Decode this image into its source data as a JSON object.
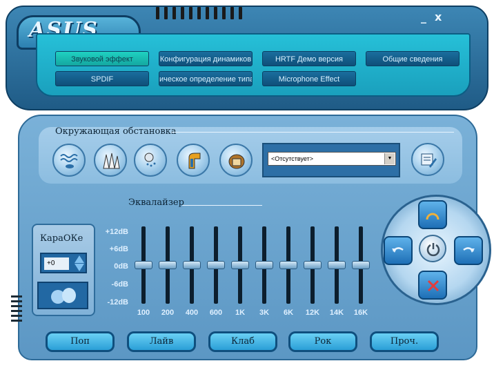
{
  "app": {
    "logo": "ASUS",
    "minimize": "_",
    "close": "x"
  },
  "nav": {
    "row1": [
      {
        "label": "Звуковой эффект",
        "active": true
      },
      {
        "label": "Конфигурация динамиков",
        "active": false
      },
      {
        "label": "HRTF Демо версия",
        "active": false
      },
      {
        "label": "Общие сведения",
        "active": false
      }
    ],
    "row2": [
      {
        "label": "SPDIF",
        "active": false
      },
      {
        "label": "ическое определение типа",
        "active": false
      },
      {
        "label": "Microphone Effect",
        "active": false
      }
    ]
  },
  "environment": {
    "title": "Окружающая обстановка",
    "icons": [
      "underwater-icon",
      "concert-hall-icon",
      "bathroom-icon",
      "sewer-pipe-icon",
      "stone-room-icon"
    ],
    "selected": "<Отсутствует>",
    "settings_icon": "settings-edit-icon"
  },
  "equalizer": {
    "title": "Эквалайзер",
    "db_labels": [
      "+12dB",
      "+6dB",
      "0dB",
      "-6dB",
      "-12dB"
    ],
    "bands": [
      {
        "freq": "100",
        "gain_db": 0
      },
      {
        "freq": "200",
        "gain_db": 0
      },
      {
        "freq": "400",
        "gain_db": 0
      },
      {
        "freq": "600",
        "gain_db": 0
      },
      {
        "freq": "1K",
        "gain_db": 0
      },
      {
        "freq": "3K",
        "gain_db": 0
      },
      {
        "freq": "6K",
        "gain_db": 0
      },
      {
        "freq": "12K",
        "gain_db": 0
      },
      {
        "freq": "14K",
        "gain_db": 0
      },
      {
        "freq": "16K",
        "gain_db": 0
      }
    ]
  },
  "karaoke": {
    "label": "КараОКе",
    "value": "+0",
    "voice_icon": "voice-cancel-icon"
  },
  "control_ring": {
    "top_icon": "rainbow-icon",
    "left_icon": "undo-icon",
    "right_icon": "redo-icon",
    "bottom_icon": "reset-x-icon",
    "center_icon": "power-icon"
  },
  "presets": [
    "Поп",
    "Лайв",
    "Клаб",
    "Рок",
    "Проч."
  ]
}
